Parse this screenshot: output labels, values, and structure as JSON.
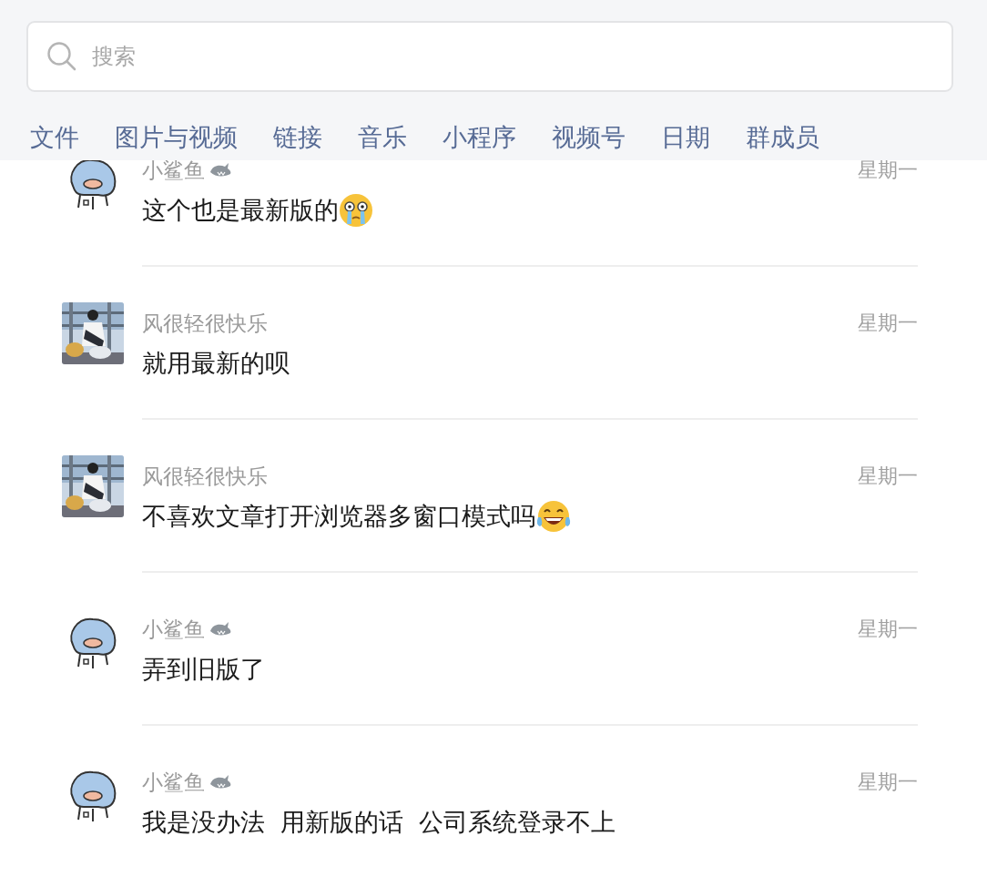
{
  "search": {
    "placeholder": "搜索"
  },
  "filters": [
    {
      "label": "文件"
    },
    {
      "label": "图片与视频"
    },
    {
      "label": "链接"
    },
    {
      "label": "音乐"
    },
    {
      "label": "小程序"
    },
    {
      "label": "视频号"
    },
    {
      "label": "日期"
    },
    {
      "label": "群成员"
    }
  ],
  "messages": [
    {
      "avatar": {
        "kind": "shark"
      },
      "name": "小鲨鱼",
      "badge": {
        "kind": "shark"
      },
      "time": "星期一",
      "text": "这个也是最新版的",
      "emoji": {
        "kind": "crying"
      }
    },
    {
      "name": "风很轻很快乐",
      "time": "星期一",
      "text": "就用最新的呗"
    },
    {
      "name": "风很轻很快乐",
      "time": "星期一",
      "text": "不喜欢文章打开浏览器多窗口模式吗",
      "emoji": {
        "kind": "laughing"
      }
    },
    {
      "avatar": {
        "kind": "shark"
      },
      "name": "小鲨鱼",
      "badge": {
        "kind": "shark"
      },
      "time": "星期一",
      "text": "弄到旧版了"
    },
    {
      "avatar": {
        "kind": "shark"
      },
      "name": "小鲨鱼",
      "badge": {
        "kind": "shark"
      },
      "time": "星期一",
      "text": "我是没办法  用新版的话  公司系统登录不上"
    }
  ]
}
